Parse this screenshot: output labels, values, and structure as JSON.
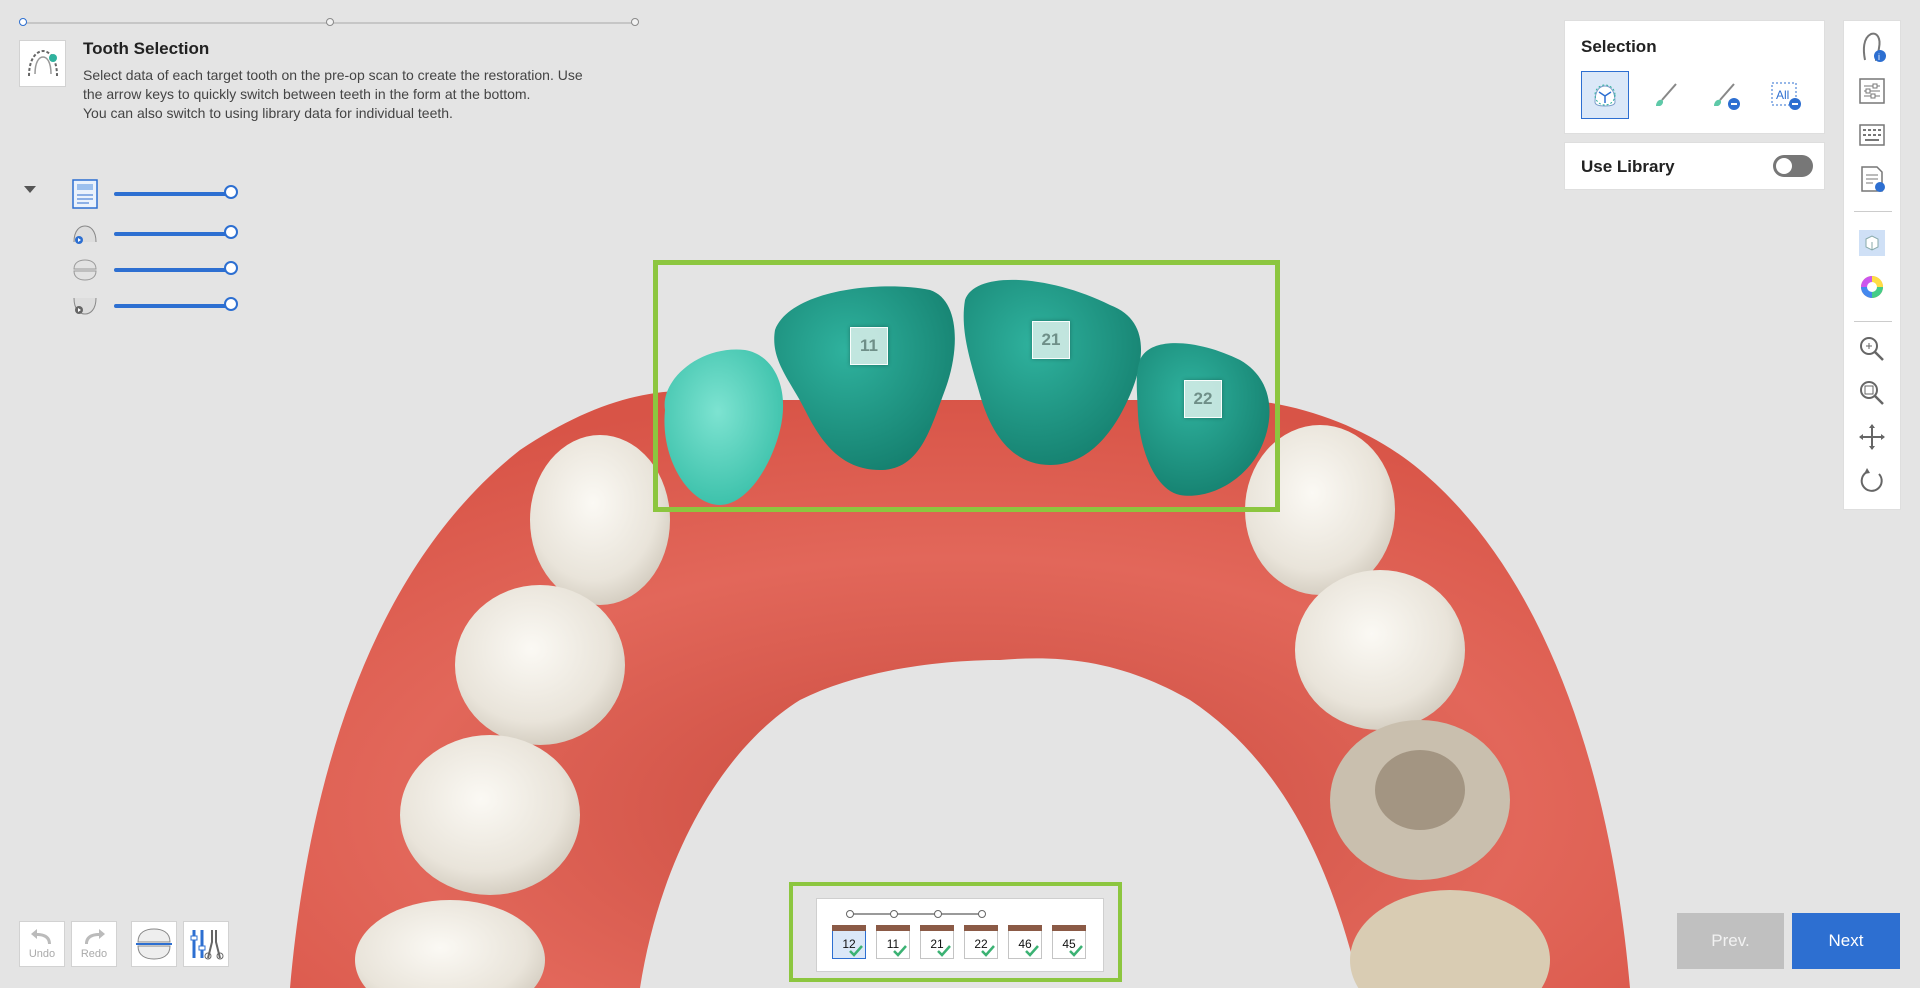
{
  "header": {
    "title": "Tooth Selection",
    "desc_lines": [
      "Select data of each target tooth on the pre-op scan to create the restoration. Use",
      "the arrow keys to quickly switch between teeth in the form at the bottom.",
      "You can also switch to using library data for individual teeth."
    ]
  },
  "steps": {
    "count": 3,
    "current": 1
  },
  "layers": [
    {
      "icon": "pre-op-scan-data-icon",
      "opacity": 1.0
    },
    {
      "icon": "maxilla-icon",
      "opacity": 1.0
    },
    {
      "icon": "occlusion-icon",
      "opacity": 1.0
    },
    {
      "icon": "mandible-icon",
      "opacity": 1.0
    }
  ],
  "selection_panel": {
    "title": "Selection",
    "tools": [
      "smart-select-icon",
      "brush-icon",
      "erase-brush-icon",
      "deselect-all-icon"
    ],
    "deselect_all_label": "All"
  },
  "library": {
    "label": "Use Library",
    "enabled": false
  },
  "toolbar_icons": [
    "model-info-icon",
    "settings-icon",
    "keyboard-icon",
    "notes-icon",
    "solid-view-icon",
    "color-icon",
    "zoom-icon",
    "zoom-fit-icon",
    "pan-icon",
    "rotate-icon"
  ],
  "bottom_left": {
    "undo_label": "Undo",
    "redo_label": "Redo"
  },
  "tooth_labels": [
    "11",
    "21",
    "22"
  ],
  "tooth_form": {
    "teeth": [
      "12",
      "11",
      "21",
      "22",
      "46",
      "45"
    ],
    "active": "12"
  },
  "nav": {
    "prev_label": "Prev.",
    "next_label": "Next"
  },
  "colors": {
    "accent": "#2d6fd1",
    "highlight_green": "#8cc63f",
    "selected_tooth": "#1f9a86",
    "gum": "#e2675a"
  }
}
